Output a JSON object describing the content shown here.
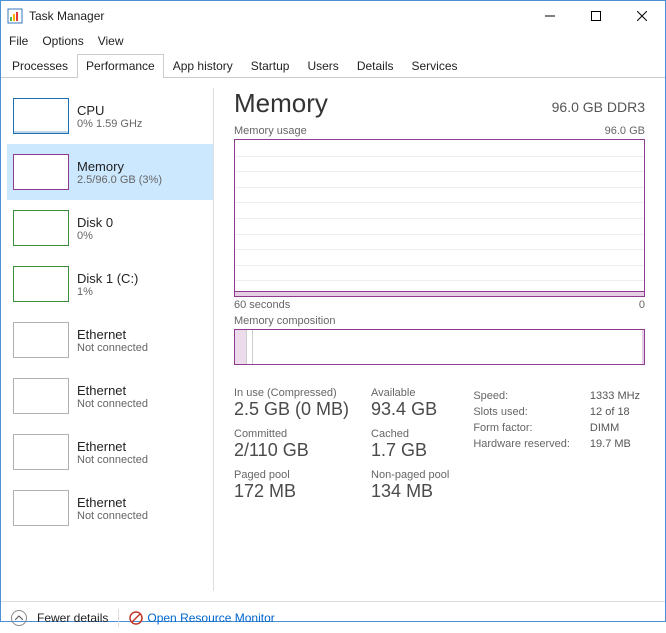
{
  "window": {
    "title": "Task Manager",
    "menus": {
      "file": "File",
      "options": "Options",
      "view": "View"
    }
  },
  "tabs": {
    "processes": "Processes",
    "performance": "Performance",
    "app_history": "App history",
    "startup": "Startup",
    "users": "Users",
    "details": "Details",
    "services": "Services"
  },
  "sidebar": {
    "items": [
      {
        "name": "CPU",
        "sub": "0% 1.59 GHz"
      },
      {
        "name": "Memory",
        "sub": "2.5/96.0 GB (3%)"
      },
      {
        "name": "Disk 0",
        "sub": "0%"
      },
      {
        "name": "Disk 1 (C:)",
        "sub": "1%"
      },
      {
        "name": "Ethernet",
        "sub": "Not connected"
      },
      {
        "name": "Ethernet",
        "sub": "Not connected"
      },
      {
        "name": "Ethernet",
        "sub": "Not connected"
      },
      {
        "name": "Ethernet",
        "sub": "Not connected"
      }
    ]
  },
  "main": {
    "title": "Memory",
    "capacity": "96.0 GB DDR3",
    "usage_label": "Memory usage",
    "usage_max": "96.0 GB",
    "axis_left": "60 seconds",
    "axis_right": "0",
    "composition_label": "Memory composition",
    "stats": {
      "inuse_label": "In use (Compressed)",
      "inuse_value": "2.5 GB (0 MB)",
      "available_label": "Available",
      "available_value": "93.4 GB",
      "committed_label": "Committed",
      "committed_value": "2/110 GB",
      "cached_label": "Cached",
      "cached_value": "1.7 GB",
      "paged_label": "Paged pool",
      "paged_value": "172 MB",
      "nonpaged_label": "Non-paged pool",
      "nonpaged_value": "134 MB"
    },
    "hw": {
      "speed_label": "Speed:",
      "speed_value": "1333 MHz",
      "slots_label": "Slots used:",
      "slots_value": "12 of 18",
      "form_label": "Form factor:",
      "form_value": "DIMM",
      "reserved_label": "Hardware reserved:",
      "reserved_value": "19.7 MB"
    }
  },
  "footer": {
    "fewer": "Fewer details",
    "resmon": "Open Resource Monitor"
  },
  "chart_data": {
    "type": "line",
    "title": "Memory usage",
    "xlabel": "seconds",
    "ylabel": "GB",
    "ylim": [
      0,
      96.0
    ],
    "x": [
      60,
      0
    ],
    "series": [
      {
        "name": "In use",
        "approx_value_gb": 2.5,
        "percent": 3
      }
    ],
    "composition": {
      "in_use_gb": 2.5,
      "modified_gb": 0.0,
      "standby_cached_gb": 1.7,
      "free_gb": 91.8,
      "hardware_reserved_mb": 19.7
    }
  }
}
